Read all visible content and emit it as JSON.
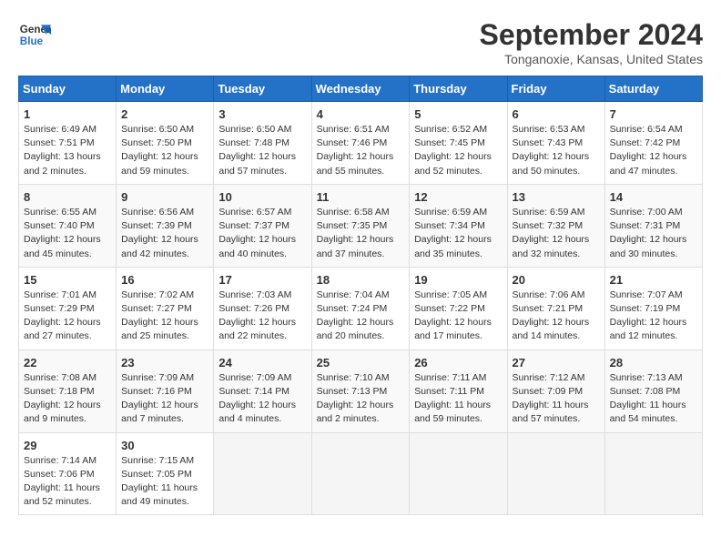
{
  "header": {
    "logo_line1": "General",
    "logo_line2": "Blue",
    "month_year": "September 2024",
    "location": "Tonganoxie, Kansas, United States"
  },
  "days_of_week": [
    "Sunday",
    "Monday",
    "Tuesday",
    "Wednesday",
    "Thursday",
    "Friday",
    "Saturday"
  ],
  "weeks": [
    [
      {
        "day": "1",
        "info": "Sunrise: 6:49 AM\nSunset: 7:51 PM\nDaylight: 13 hours\nand 2 minutes."
      },
      {
        "day": "2",
        "info": "Sunrise: 6:50 AM\nSunset: 7:50 PM\nDaylight: 12 hours\nand 59 minutes."
      },
      {
        "day": "3",
        "info": "Sunrise: 6:50 AM\nSunset: 7:48 PM\nDaylight: 12 hours\nand 57 minutes."
      },
      {
        "day": "4",
        "info": "Sunrise: 6:51 AM\nSunset: 7:46 PM\nDaylight: 12 hours\nand 55 minutes."
      },
      {
        "day": "5",
        "info": "Sunrise: 6:52 AM\nSunset: 7:45 PM\nDaylight: 12 hours\nand 52 minutes."
      },
      {
        "day": "6",
        "info": "Sunrise: 6:53 AM\nSunset: 7:43 PM\nDaylight: 12 hours\nand 50 minutes."
      },
      {
        "day": "7",
        "info": "Sunrise: 6:54 AM\nSunset: 7:42 PM\nDaylight: 12 hours\nand 47 minutes."
      }
    ],
    [
      {
        "day": "8",
        "info": "Sunrise: 6:55 AM\nSunset: 7:40 PM\nDaylight: 12 hours\nand 45 minutes."
      },
      {
        "day": "9",
        "info": "Sunrise: 6:56 AM\nSunset: 7:39 PM\nDaylight: 12 hours\nand 42 minutes."
      },
      {
        "day": "10",
        "info": "Sunrise: 6:57 AM\nSunset: 7:37 PM\nDaylight: 12 hours\nand 40 minutes."
      },
      {
        "day": "11",
        "info": "Sunrise: 6:58 AM\nSunset: 7:35 PM\nDaylight: 12 hours\nand 37 minutes."
      },
      {
        "day": "12",
        "info": "Sunrise: 6:59 AM\nSunset: 7:34 PM\nDaylight: 12 hours\nand 35 minutes."
      },
      {
        "day": "13",
        "info": "Sunrise: 6:59 AM\nSunset: 7:32 PM\nDaylight: 12 hours\nand 32 minutes."
      },
      {
        "day": "14",
        "info": "Sunrise: 7:00 AM\nSunset: 7:31 PM\nDaylight: 12 hours\nand 30 minutes."
      }
    ],
    [
      {
        "day": "15",
        "info": "Sunrise: 7:01 AM\nSunset: 7:29 PM\nDaylight: 12 hours\nand 27 minutes."
      },
      {
        "day": "16",
        "info": "Sunrise: 7:02 AM\nSunset: 7:27 PM\nDaylight: 12 hours\nand 25 minutes."
      },
      {
        "day": "17",
        "info": "Sunrise: 7:03 AM\nSunset: 7:26 PM\nDaylight: 12 hours\nand 22 minutes."
      },
      {
        "day": "18",
        "info": "Sunrise: 7:04 AM\nSunset: 7:24 PM\nDaylight: 12 hours\nand 20 minutes."
      },
      {
        "day": "19",
        "info": "Sunrise: 7:05 AM\nSunset: 7:22 PM\nDaylight: 12 hours\nand 17 minutes."
      },
      {
        "day": "20",
        "info": "Sunrise: 7:06 AM\nSunset: 7:21 PM\nDaylight: 12 hours\nand 14 minutes."
      },
      {
        "day": "21",
        "info": "Sunrise: 7:07 AM\nSunset: 7:19 PM\nDaylight: 12 hours\nand 12 minutes."
      }
    ],
    [
      {
        "day": "22",
        "info": "Sunrise: 7:08 AM\nSunset: 7:18 PM\nDaylight: 12 hours\nand 9 minutes."
      },
      {
        "day": "23",
        "info": "Sunrise: 7:09 AM\nSunset: 7:16 PM\nDaylight: 12 hours\nand 7 minutes."
      },
      {
        "day": "24",
        "info": "Sunrise: 7:09 AM\nSunset: 7:14 PM\nDaylight: 12 hours\nand 4 minutes."
      },
      {
        "day": "25",
        "info": "Sunrise: 7:10 AM\nSunset: 7:13 PM\nDaylight: 12 hours\nand 2 minutes."
      },
      {
        "day": "26",
        "info": "Sunrise: 7:11 AM\nSunset: 7:11 PM\nDaylight: 11 hours\nand 59 minutes."
      },
      {
        "day": "27",
        "info": "Sunrise: 7:12 AM\nSunset: 7:09 PM\nDaylight: 11 hours\nand 57 minutes."
      },
      {
        "day": "28",
        "info": "Sunrise: 7:13 AM\nSunset: 7:08 PM\nDaylight: 11 hours\nand 54 minutes."
      }
    ],
    [
      {
        "day": "29",
        "info": "Sunrise: 7:14 AM\nSunset: 7:06 PM\nDaylight: 11 hours\nand 52 minutes."
      },
      {
        "day": "30",
        "info": "Sunrise: 7:15 AM\nSunset: 7:05 PM\nDaylight: 11 hours\nand 49 minutes."
      },
      {
        "day": "",
        "info": ""
      },
      {
        "day": "",
        "info": ""
      },
      {
        "day": "",
        "info": ""
      },
      {
        "day": "",
        "info": ""
      },
      {
        "day": "",
        "info": ""
      }
    ]
  ]
}
